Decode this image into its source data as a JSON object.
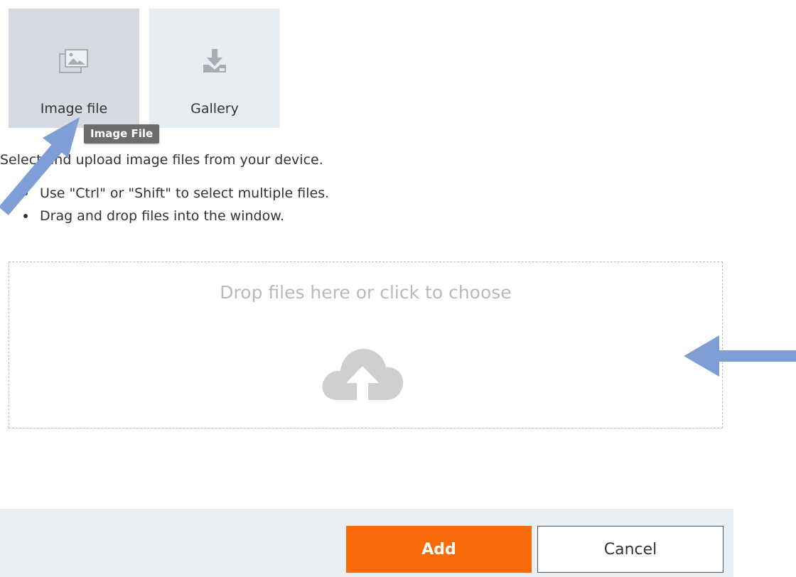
{
  "source_tabs": [
    {
      "label": "Image file",
      "icon": "image-file-icon",
      "selected": true
    },
    {
      "label": "Gallery",
      "icon": "gallery-download-icon",
      "selected": false
    }
  ],
  "tooltip": "Image File",
  "instructions": {
    "intro": "Select and upload image files from your device.",
    "tips": [
      "Use \"Ctrl\" or \"Shift\" to select multiple files.",
      "Drag and drop files into the window."
    ]
  },
  "dropzone": {
    "text": "Drop files here or click to choose",
    "icon": "cloud-upload-icon"
  },
  "footer": {
    "add_label": "Add",
    "cancel_label": "Cancel"
  },
  "colors": {
    "accent": "#f76b0a",
    "tile_bg": "#e8edf2",
    "tile_selected_bg": "#d5dbe1",
    "footer_bg": "#eaeff4",
    "tooltip_bg": "#6c6c6c",
    "annotation_arrow": "#7f9ed6"
  }
}
